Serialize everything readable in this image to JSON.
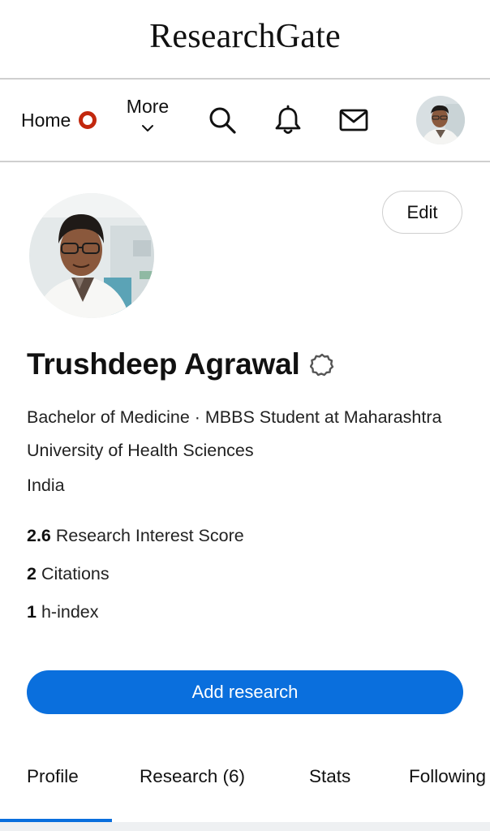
{
  "brand": {
    "name": "ResearchGate"
  },
  "nav": {
    "home_label": "Home",
    "more_label": "More",
    "icons": [
      "search-icon",
      "bell-icon",
      "mail-icon",
      "avatar"
    ]
  },
  "profile": {
    "edit_label": "Edit",
    "name": "Trushdeep Agrawal",
    "degree": "Bachelor of Medicine · MBBS Student at Maharashtra University of Health Sciences",
    "country": "India",
    "stats": [
      {
        "value": "2.6",
        "label": "Research Interest Score"
      },
      {
        "value": "2",
        "label": "Citations"
      },
      {
        "value": "1",
        "label": "h-index"
      }
    ],
    "add_research_label": "Add research"
  },
  "tabs": [
    {
      "label": "Profile",
      "active": true
    },
    {
      "label": "Research (6)",
      "active": false
    },
    {
      "label": "Stats",
      "active": false
    },
    {
      "label": "Following",
      "active": false
    }
  ],
  "colors": {
    "accent": "#0a6fdd",
    "home_indicator": "#c2280e"
  }
}
